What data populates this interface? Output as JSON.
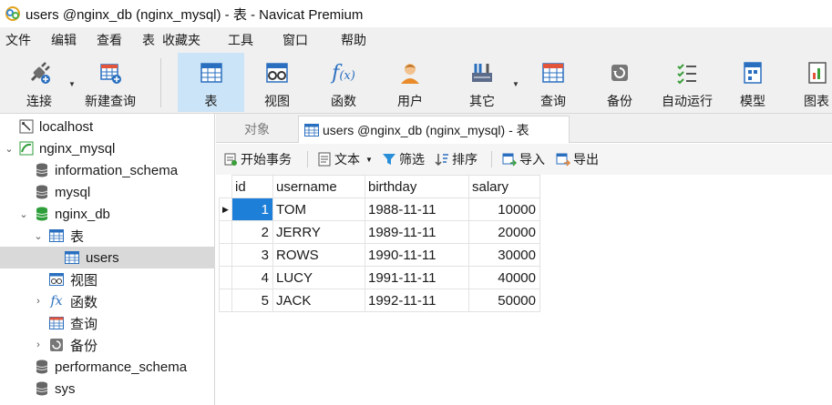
{
  "window": {
    "title": "users @nginx_db (nginx_mysql) - 表 - Navicat Premium"
  },
  "menu": [
    "文件",
    "编辑",
    "查看",
    "表",
    "收藏夹",
    "工具",
    "窗口",
    "帮助"
  ],
  "toolbar": {
    "connect": "连接",
    "new_query": "新建查询",
    "table": "表",
    "view": "视图",
    "function": "函数",
    "user": "用户",
    "other": "其它",
    "query": "查询",
    "backup": "备份",
    "automation": "自动运行",
    "model": "模型",
    "chart": "图表"
  },
  "sidebar": {
    "items": [
      {
        "label": "localhost"
      },
      {
        "label": "nginx_mysql"
      },
      {
        "label": "information_schema"
      },
      {
        "label": "mysql"
      },
      {
        "label": "nginx_db"
      },
      {
        "label": "表"
      },
      {
        "label": "users"
      },
      {
        "label": "视图"
      },
      {
        "label": "函数"
      },
      {
        "label": "查询"
      },
      {
        "label": "备份"
      },
      {
        "label": "performance_schema"
      },
      {
        "label": "sys"
      }
    ]
  },
  "tabs": {
    "objects": "对象",
    "active": "users @nginx_db (nginx_mysql) - 表"
  },
  "table_toolbar": {
    "begin_transaction": "开始事务",
    "text": "文本",
    "filter": "筛选",
    "sort": "排序",
    "import": "导入",
    "export": "导出"
  },
  "grid": {
    "columns": [
      "id",
      "username",
      "birthday",
      "salary"
    ],
    "rows": [
      {
        "id": "1",
        "username": "TOM",
        "birthday": "1988-11-11",
        "salary": "10000"
      },
      {
        "id": "2",
        "username": "JERRY",
        "birthday": "1989-11-11",
        "salary": "20000"
      },
      {
        "id": "3",
        "username": "ROWS",
        "birthday": "1990-11-11",
        "salary": "30000"
      },
      {
        "id": "4",
        "username": "LUCY",
        "birthday": "1991-11-11",
        "salary": "40000"
      },
      {
        "id": "5",
        "username": "JACK",
        "birthday": "1992-11-11",
        "salary": "50000"
      }
    ]
  },
  "colors": {
    "selection": "#1e7fd8",
    "active_tool": "#cce4f7",
    "mysql_green": "#2e9e3a",
    "accent_blue": "#2a6fbf"
  }
}
